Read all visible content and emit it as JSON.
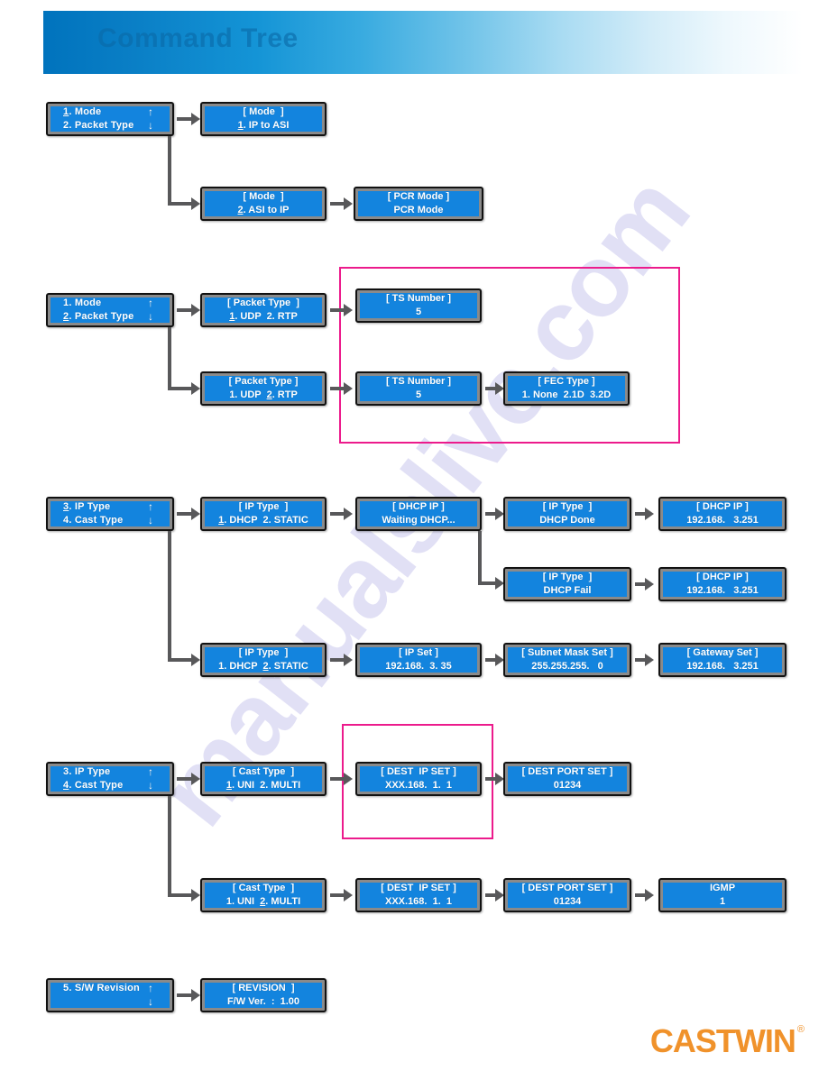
{
  "header": {
    "title": "Command Tree",
    "banner_color_start": "#0073bd",
    "banner_color_end": "#ffffff",
    "title_color": "#0a6aa8"
  },
  "watermark": {
    "text": "manualslive.com",
    "color": "#b9b6e8"
  },
  "footer": {
    "logo_text": "CASTWIN",
    "registered_mark": "®",
    "logo_color": "#f0922b"
  },
  "theme": {
    "lcd_screen_color": "#1384de",
    "lcd_bezel_color": "#8a8a8a",
    "lcd_border_color": "#111111",
    "lcd_text_color": "#ffffff",
    "connector_color": "#58585a",
    "highlight_color": "#ec1b8c"
  },
  "arrows": {
    "up": "↑",
    "down": "↓"
  },
  "sections": [
    {
      "id": "mode",
      "menu": {
        "line1_label": "1. Mode",
        "line1_underline": "1",
        "line1_arrow": "↑",
        "line2_label": "2. Packet Type",
        "line2_arrow": "↓"
      },
      "branches": [
        {
          "title": "[ Mode  ]",
          "value": "1. IP to ASI",
          "underline": "1"
        },
        {
          "title": "[ Mode  ]",
          "value": "2. ASI to IP",
          "underline": "2"
        }
      ],
      "followup": {
        "title": "[ PCR Mode ]",
        "value": "PCR Mode"
      }
    },
    {
      "id": "packet-type",
      "menu": {
        "line1_label": "1. Mode",
        "line1_arrow": "↑",
        "line2_label": "2. Packet Type",
        "line2_underline": "2",
        "line2_arrow": "↓"
      },
      "branches": [
        {
          "title": "[ Packet Type  ]",
          "value": "1. UDP  2. RTP",
          "underline": "1"
        },
        {
          "title": "[ Packet Type ]",
          "value": "1. UDP  2. RTP",
          "underline": "2"
        }
      ],
      "ts_number_top": {
        "title": "[ TS Number ]",
        "value": "5"
      },
      "ts_number_bottom": {
        "title": "[ TS Number ]",
        "value": "5"
      },
      "fec_type": {
        "title": "[ FEC Type ]",
        "value": "1. None  2.1D  3.2D"
      },
      "highlight": true
    },
    {
      "id": "ip-type",
      "menu": {
        "line1_label": "3. IP Type",
        "line1_underline": "3",
        "line1_arrow": "↑",
        "line2_label": "4. Cast Type",
        "line2_arrow": "↓"
      },
      "branch_dhcp": {
        "title": "[ IP Type  ]",
        "value": "1. DHCP  2. STATIC",
        "underline": "1"
      },
      "dhcp_waiting": {
        "title": "[ DHCP IP ]",
        "value": "Waiting DHCP..."
      },
      "dhcp_done": {
        "title": "[ IP Type  ]",
        "value": "DHCP Done"
      },
      "dhcp_done_ip": {
        "title": "[ DHCP IP ]",
        "value": "192.168.   3.251"
      },
      "dhcp_fail": {
        "title": "[ IP Type  ]",
        "value": "DHCP Fail"
      },
      "dhcp_fail_ip": {
        "title": "[ DHCP IP ]",
        "value": "192.168.   3.251"
      },
      "branch_static": {
        "title": "[ IP Type  ]",
        "value": "1. DHCP  2. STATIC",
        "underline": "2"
      },
      "ip_set": {
        "title": "[ IP Set ]",
        "value": "192.168.  3. 35"
      },
      "subnet_mask_set": {
        "title": "[ Subnet Mask Set ]",
        "value": "255.255.255.   0"
      },
      "gateway_set": {
        "title": "[ Gateway Set ]",
        "value": "192.168.   3.251"
      }
    },
    {
      "id": "cast-type",
      "menu": {
        "line1_label": "3. IP Type",
        "line1_arrow": "↑",
        "line2_label": "4. Cast Type",
        "line2_underline": "4",
        "line2_arrow": "↓"
      },
      "branch_uni": {
        "title": "[ Cast Type  ]",
        "value": "1. UNI  2. MULTI",
        "underline": "1"
      },
      "uni_dest_ip": {
        "title": "[ DEST  IP SET ]",
        "value": "XXX.168.  1.  1"
      },
      "uni_dest_port": {
        "title": "[ DEST PORT SET ]",
        "value": "01234"
      },
      "branch_multi": {
        "title": "[ Cast Type  ]",
        "value": "1. UNI  2. MULTI",
        "underline": "2"
      },
      "multi_dest_ip": {
        "title": "[ DEST  IP SET ]",
        "value": "XXX.168.  1.  1"
      },
      "multi_dest_port": {
        "title": "[ DEST PORT SET ]",
        "value": "01234"
      },
      "igmp": {
        "title": "IGMP",
        "value": "1"
      },
      "highlight": true
    },
    {
      "id": "revision",
      "menu": {
        "line1_label": "5. S/W Revision",
        "line1_arrow": "↑",
        "line2_label": "",
        "line2_arrow": "↓"
      },
      "revision": {
        "title": "[ REVISION  ]",
        "value": "F/W Ver.  :  1.00"
      }
    }
  ]
}
